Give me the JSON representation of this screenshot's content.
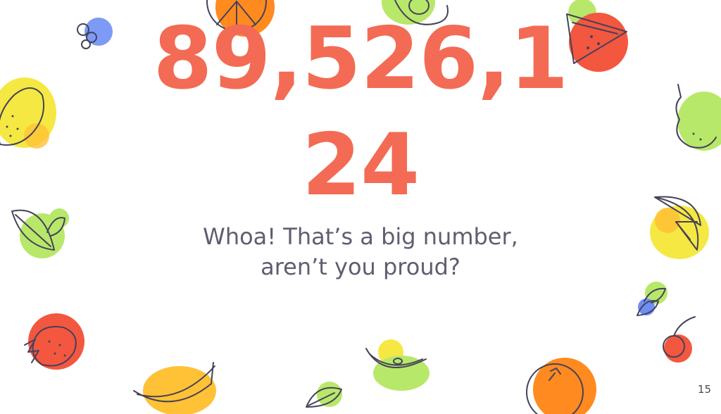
{
  "slide": {
    "big_number_line1": "89,526,1",
    "big_number_line2": "24",
    "subtitle_line1": "Whoa! That’s a big number,",
    "subtitle_line2": "aren’t you proud?",
    "page_number": "15"
  },
  "colors": {
    "accent": "#f36b54",
    "text": "#5e5e70",
    "yellow": "#f5e842",
    "green": "#b8e86a",
    "orange": "#ff8a1f",
    "blue": "#6f8ff5",
    "red": "#f3573f"
  },
  "decorations": [
    "blueberries-icon",
    "orange-slice-icon",
    "avocado-icon",
    "watermelon-icon",
    "lemon-icon",
    "pear-icon",
    "leaves-icon",
    "lemon-slice-icon",
    "small-leaves-icon",
    "cherry-icon",
    "strawberry-icon",
    "banana-icon",
    "apple-slice-icon",
    "leaf-icon",
    "orange-icon"
  ]
}
